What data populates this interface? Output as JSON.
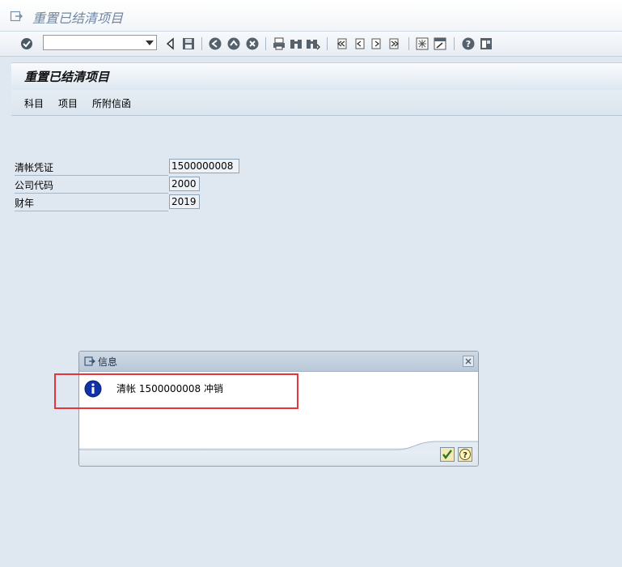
{
  "window": {
    "title": "重置已结清项目",
    "icon": "exit-icon"
  },
  "toolbar": {
    "command_field_value": "",
    "icons": [
      "enter-icon",
      "back-triangle-icon",
      "save-icon",
      "back-icon",
      "exit-icon",
      "cancel-icon",
      "print-icon",
      "find-icon",
      "find-next-icon",
      "first-page-icon",
      "previous-page-icon",
      "next-page-icon",
      "last-page-icon",
      "create-session-icon",
      "shortcut-icon",
      "help-icon",
      "customize-layout-icon"
    ]
  },
  "screen": {
    "title": "重置已结清项目",
    "menu": [
      "科目",
      "项目",
      "所附信函"
    ]
  },
  "form": {
    "fields": [
      {
        "label": "清帐凭证",
        "value": "1500000008"
      },
      {
        "label": "公司代码",
        "value": "2000"
      },
      {
        "label": "财年",
        "value": "2019"
      }
    ]
  },
  "dialog": {
    "title": "信息",
    "message": "清帐 1500000008 冲销",
    "icons": [
      "info-icon",
      "close-icon",
      "continue-check-icon",
      "help-icon"
    ]
  },
  "colors": {
    "highlight": "#e8333a",
    "background": "#dfe7f0",
    "info_icon": "#1233a8"
  }
}
